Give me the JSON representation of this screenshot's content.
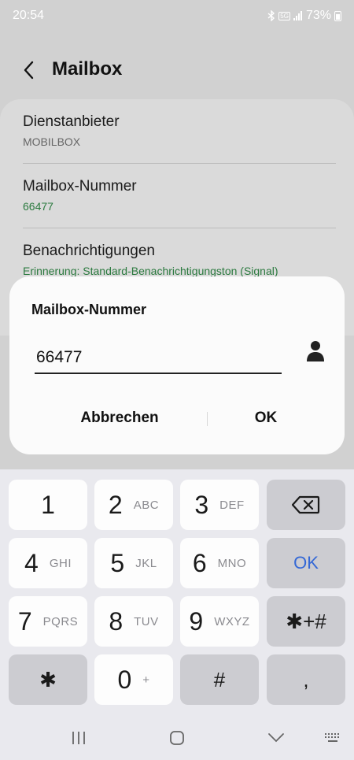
{
  "status_bar": {
    "time": "20:54",
    "battery": "73%",
    "icons": [
      "bluetooth-icon",
      "5g-icon",
      "signal-icon",
      "battery-icon"
    ],
    "network_label": "5G"
  },
  "header": {
    "title": "Mailbox",
    "back_icon": "chevron-left-icon"
  },
  "settings": {
    "items": [
      {
        "title": "Dienstanbieter",
        "value": "MOBILBOX"
      },
      {
        "title": "Mailbox-Nummer",
        "value": "66477"
      },
      {
        "title": "Benachrichtigungen",
        "value": "Erinnerung: Standard-Benachrichtigungston (Signal)"
      }
    ]
  },
  "dialog": {
    "title": "Mailbox-Nummer",
    "input_value": "66477",
    "contact_icon": "contact-person-icon",
    "cancel_label": "Abbrechen",
    "ok_label": "OK"
  },
  "keypad": {
    "keys": [
      {
        "digit": "1",
        "letters": ""
      },
      {
        "digit": "2",
        "letters": "ABC"
      },
      {
        "digit": "3",
        "letters": "DEF"
      },
      {
        "digit": "4",
        "letters": "GHI"
      },
      {
        "digit": "5",
        "letters": "JKL"
      },
      {
        "digit": "6",
        "letters": "MNO"
      },
      {
        "digit": "7",
        "letters": "PQRS"
      },
      {
        "digit": "8",
        "letters": "TUV"
      },
      {
        "digit": "9",
        "letters": "WXYZ"
      },
      {
        "digit": "0",
        "letters": "+"
      }
    ],
    "backspace_icon": "backspace-icon",
    "ok_label": "OK",
    "star_plus_hash": "✱+#",
    "star": "✱",
    "hash": "#",
    "comma": ","
  },
  "navbar": {
    "icons": [
      "recent-apps-icon",
      "home-icon",
      "back-chevron-down-icon",
      "keyboard-icon"
    ]
  },
  "colors": {
    "green_value": "#2b7a3f",
    "accent_blue": "#3468d6",
    "dim_background": "#d1d1d1"
  }
}
